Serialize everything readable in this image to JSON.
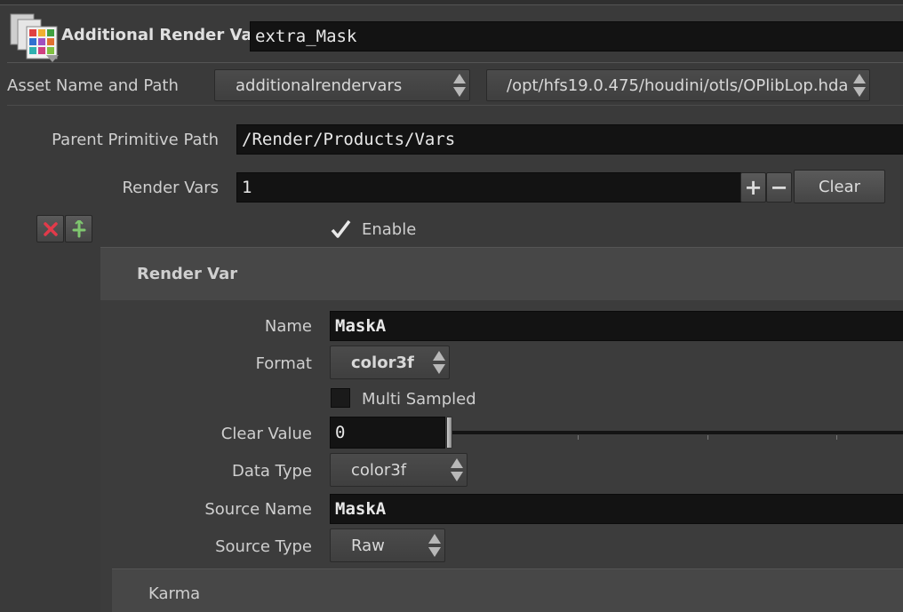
{
  "header": {
    "node_type_label": "Additional Render Vars",
    "node_name": "extra_Mask"
  },
  "asset": {
    "label": "Asset Name and Path",
    "name_menu": "additionalrendervars",
    "path_menu": "/opt/hfs19.0.475/houdini/otls/OPlibLop.hda"
  },
  "params": {
    "parent_primitive_path_label": "Parent Primitive Path",
    "parent_primitive_path": "/Render/Products/Vars",
    "render_vars_label": "Render Vars",
    "render_vars_count": "1",
    "add_symbol": "+",
    "remove_symbol": "−",
    "clear_label": "Clear",
    "enable_label": "Enable"
  },
  "render_var": {
    "section_title": "Render Var",
    "name_label": "Name",
    "name_value": "MaskA",
    "format_label": "Format",
    "format_value": "color3f",
    "multi_sampled_label": "Multi Sampled",
    "clear_value_label": "Clear Value",
    "clear_value": "0",
    "clear_value_slider_fraction": 0.0,
    "data_type_label": "Data Type",
    "data_type_value": "color3f",
    "source_name_label": "Source Name",
    "source_name_value": "MaskA",
    "source_type_label": "Source Type",
    "source_type_value": "Raw"
  },
  "karma": {
    "section_title": "Karma"
  },
  "colors": {
    "background": "#3a3a3a",
    "field": "#131313",
    "section": "#474747",
    "remove_red": "#e23a4a",
    "insert_green": "#7fc76f"
  }
}
